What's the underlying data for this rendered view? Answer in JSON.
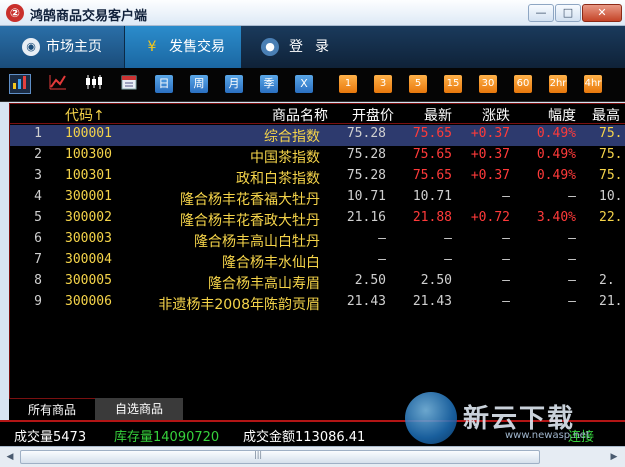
{
  "window": {
    "title": "鸿鹄商品交易客户端",
    "logo_glyph": "②",
    "minimize": "—",
    "maximize": "□",
    "close": "✕"
  },
  "nav": {
    "home": "市场主页",
    "sale": "发售交易",
    "login": "登录",
    "sale_icon": "¥"
  },
  "toolbar": {
    "icons": [
      "bar-chart-icon",
      "line-chart-icon",
      "candlestick-icon",
      "calendar-icon"
    ],
    "periods_blue": [
      "日",
      "周",
      "月",
      "季",
      "X"
    ],
    "periods_orange": [
      "1",
      "3",
      "5",
      "15",
      "30",
      "60",
      "2hr",
      "4hr"
    ]
  },
  "table": {
    "headers": {
      "code": "代码↑",
      "name": "商品名称",
      "open": "开盘价",
      "last": "最新",
      "change": "涨跌",
      "amplitude": "幅度",
      "high": "最高"
    },
    "rows": [
      {
        "num": "1",
        "code": "100001",
        "name": "综合指数",
        "open": "75.28",
        "last": "75.65",
        "change": "+0.37",
        "amplitude": "0.49%",
        "high": "75."
      },
      {
        "num": "2",
        "code": "100300",
        "name": "中国茶指数",
        "open": "75.28",
        "last": "75.65",
        "change": "+0.37",
        "amplitude": "0.49%",
        "high": "75."
      },
      {
        "num": "3",
        "code": "100301",
        "name": "政和白茶指数",
        "open": "75.28",
        "last": "75.65",
        "change": "+0.37",
        "amplitude": "0.49%",
        "high": "75."
      },
      {
        "num": "4",
        "code": "300001",
        "name": "隆合杨丰花香福大牡丹",
        "open": "10.71",
        "last": "10.71",
        "change": "—",
        "amplitude": "—",
        "high": "10."
      },
      {
        "num": "5",
        "code": "300002",
        "name": "隆合杨丰花香政大牡丹",
        "open": "21.16",
        "last": "21.88",
        "change": "+0.72",
        "amplitude": "3.40%",
        "high": "22."
      },
      {
        "num": "6",
        "code": "300003",
        "name": "隆合杨丰高山白牡丹",
        "open": "—",
        "last": "—",
        "change": "—",
        "amplitude": "—",
        "high": ""
      },
      {
        "num": "7",
        "code": "300004",
        "name": "隆合杨丰水仙白",
        "open": "—",
        "last": "—",
        "change": "—",
        "amplitude": "—",
        "high": ""
      },
      {
        "num": "8",
        "code": "300005",
        "name": "隆合杨丰高山寿眉",
        "open": "2.50",
        "last": "2.50",
        "change": "—",
        "amplitude": "—",
        "high": "2."
      },
      {
        "num": "9",
        "code": "300006",
        "name": "非遗杨丰2008年陈韵贡眉",
        "open": "21.43",
        "last": "21.43",
        "change": "—",
        "amplitude": "—",
        "high": "21."
      }
    ]
  },
  "bottom_tabs": {
    "all": "所有商品",
    "watch": "自选商品"
  },
  "status": {
    "volume": "成交量5473",
    "stock": "库存量14090720",
    "amount": "成交金额113086.41",
    "connection": "连接"
  },
  "watermark": {
    "text": "新云下载",
    "sub": "www.newasp.net"
  },
  "colors": {
    "up": "#ff3a3a",
    "flat": "#d0d0d0",
    "code": "#f5d44a",
    "status_green": "#36d23c"
  }
}
